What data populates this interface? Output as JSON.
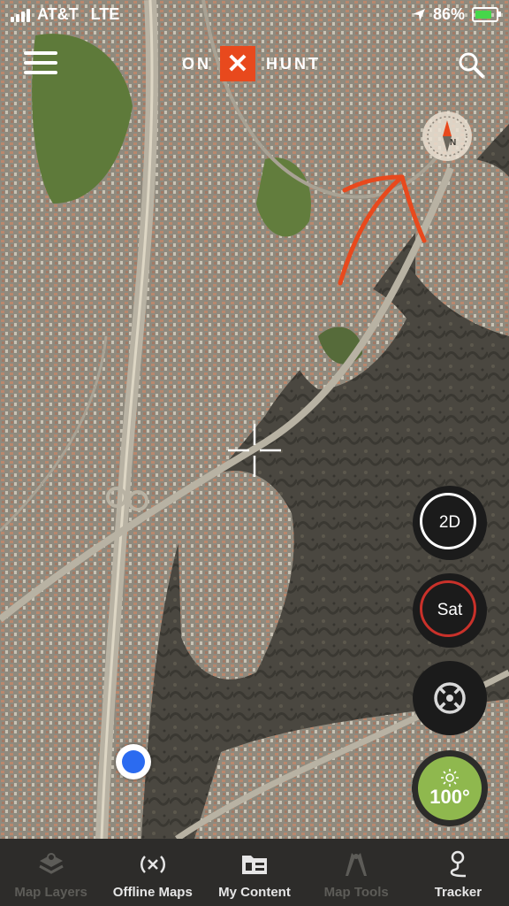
{
  "status_bar": {
    "carrier": "AT&T",
    "network": "LTE",
    "battery": "86%"
  },
  "header": {
    "logo_left": "ON",
    "logo_right": "HUNT"
  },
  "map_controls": {
    "view_mode": "2D",
    "layer_mode": "Sat",
    "temperature": "100°"
  },
  "tabs": [
    {
      "label": "Map Layers",
      "icon": "map-layers-icon",
      "enabled": false
    },
    {
      "label": "Offline Maps",
      "icon": "offline-maps-icon",
      "enabled": true
    },
    {
      "label": "My Content",
      "icon": "my-content-icon",
      "enabled": true
    },
    {
      "label": "Map Tools",
      "icon": "map-tools-icon",
      "enabled": false
    },
    {
      "label": "Tracker",
      "icon": "tracker-icon",
      "enabled": true
    }
  ],
  "colors": {
    "brand": "#e8491d",
    "annotation_arrow": "#e8491d",
    "location": "#2b6bf0",
    "weather": "#8fb84e"
  }
}
